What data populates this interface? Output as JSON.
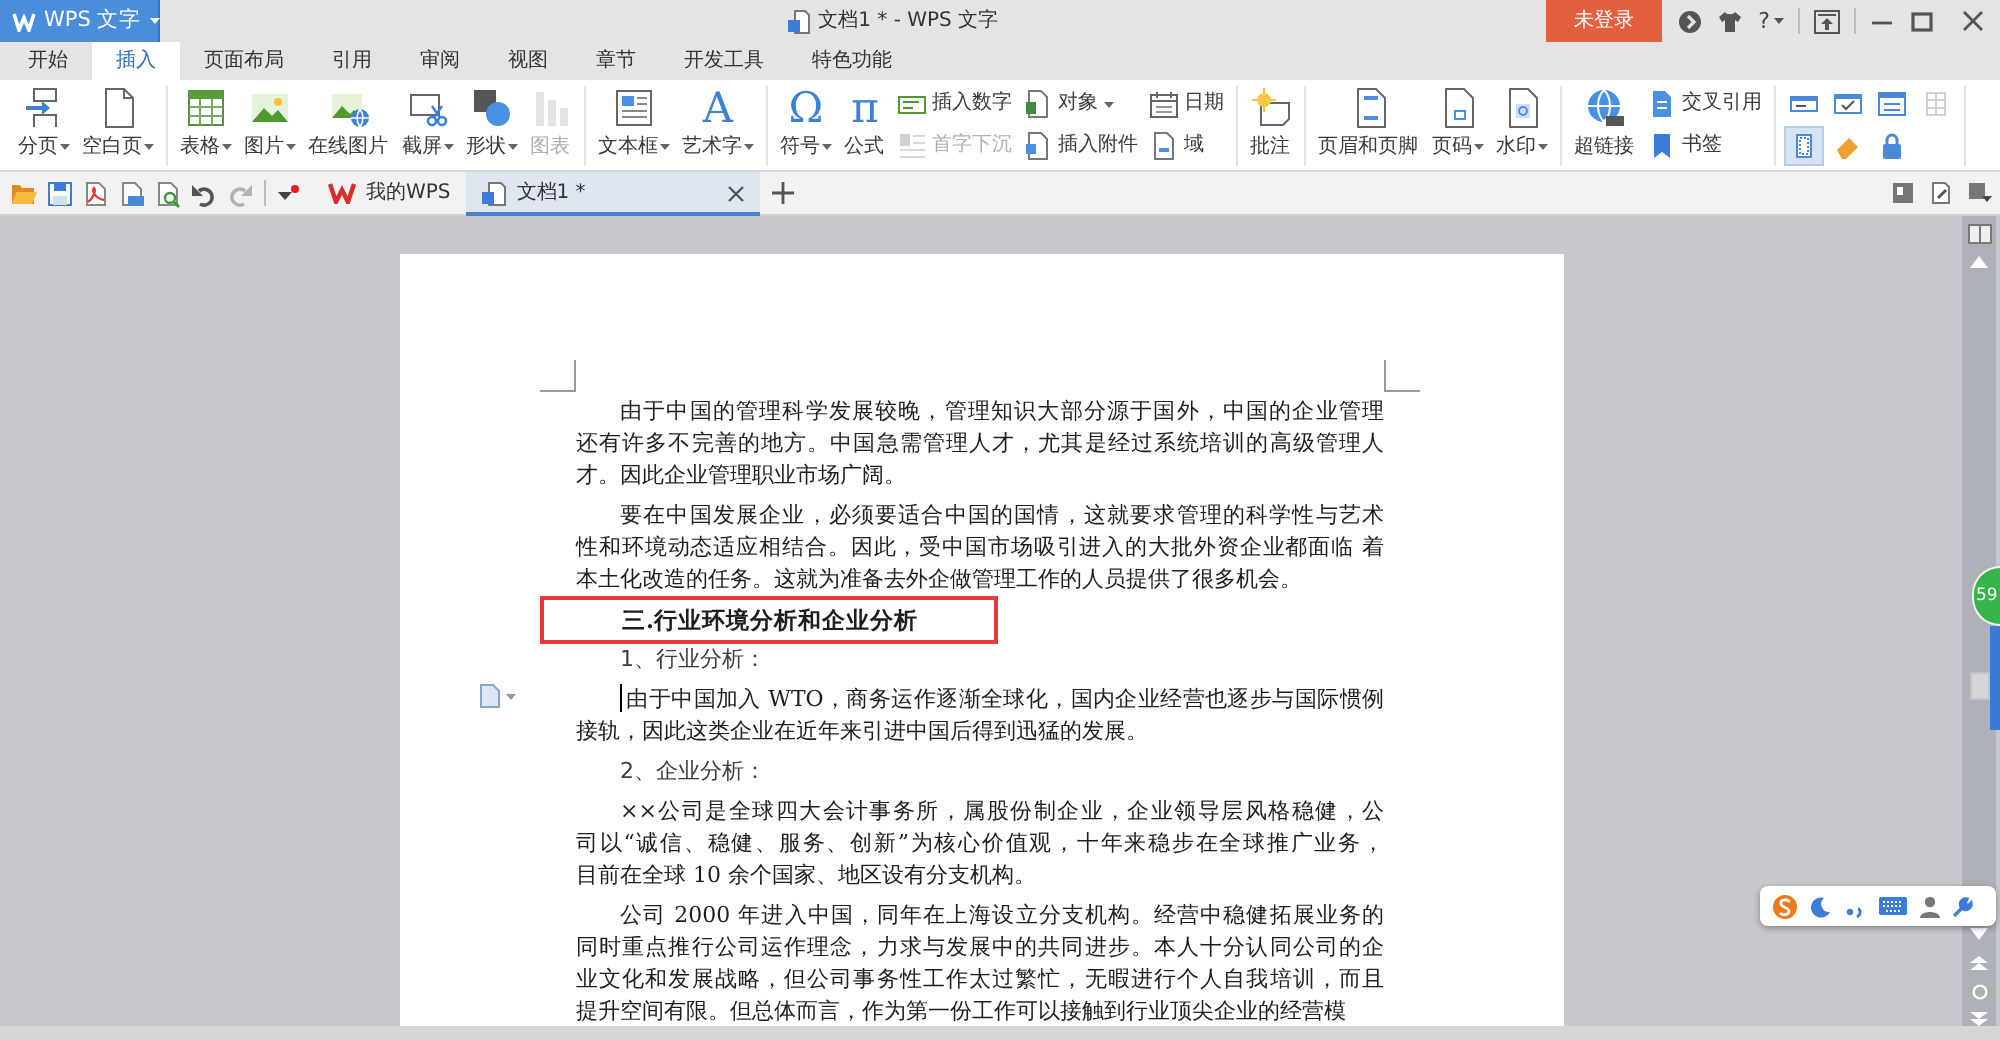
{
  "app_menu": {
    "label": "WPS 文字"
  },
  "window": {
    "title": "文档1 * - WPS 文字"
  },
  "account": {
    "label": "未登录"
  },
  "help": {
    "label": "?"
  },
  "ribbon_tabs": [
    {
      "label": "开始",
      "selected": false
    },
    {
      "label": "插入",
      "selected": true
    },
    {
      "label": "页面布局",
      "selected": false
    },
    {
      "label": "引用",
      "selected": false
    },
    {
      "label": "审阅",
      "selected": false
    },
    {
      "label": "视图",
      "selected": false
    },
    {
      "label": "章节",
      "selected": false
    },
    {
      "label": "开发工具",
      "selected": false
    },
    {
      "label": "特色功能",
      "selected": false
    }
  ],
  "ribbon_groups": [
    {
      "items": [
        {
          "kind": "large",
          "label": "分页",
          "dropdown": true,
          "disabled": false
        },
        {
          "kind": "large",
          "label": "空白页",
          "dropdown": true,
          "disabled": false
        }
      ]
    },
    {
      "items": [
        {
          "kind": "large",
          "label": "表格",
          "dropdown": true,
          "disabled": false
        },
        {
          "kind": "large",
          "label": "图片",
          "dropdown": true,
          "disabled": false
        },
        {
          "kind": "large",
          "label": "在线图片",
          "dropdown": false,
          "disabled": false
        },
        {
          "kind": "large",
          "label": "截屏",
          "dropdown": true,
          "disabled": false
        },
        {
          "kind": "large",
          "label": "形状",
          "dropdown": true,
          "disabled": false
        },
        {
          "kind": "large",
          "label": "图表",
          "dropdown": false,
          "disabled": true
        }
      ]
    },
    {
      "items": [
        {
          "kind": "large",
          "label": "文本框",
          "dropdown": true,
          "disabled": false
        },
        {
          "kind": "large",
          "label": "艺术字",
          "glyph": "A",
          "dropdown": true,
          "disabled": false
        }
      ]
    },
    {
      "items": [
        {
          "kind": "large",
          "label": "符号",
          "glyph": "Ω",
          "dropdown": true,
          "disabled": false
        },
        {
          "kind": "large",
          "label": "公式",
          "glyph": "π",
          "dropdown": false,
          "disabled": false
        },
        {
          "kind": "small",
          "label": "插入数字",
          "dropdown": false,
          "disabled": false
        },
        {
          "kind": "small",
          "label": "首字下沉",
          "dropdown": false,
          "disabled": true
        },
        {
          "kind": "small",
          "label": "对象",
          "dropdown": true,
          "disabled": false
        },
        {
          "kind": "small",
          "label": "插入附件",
          "dropdown": false,
          "disabled": false
        },
        {
          "kind": "small",
          "label": "日期",
          "dropdown": false,
          "disabled": false
        },
        {
          "kind": "small",
          "label": "域",
          "dropdown": false,
          "disabled": false
        }
      ]
    },
    {
      "items": [
        {
          "kind": "large",
          "label": "批注",
          "dropdown": false,
          "disabled": false
        }
      ]
    },
    {
      "items": [
        {
          "kind": "large",
          "label": "页眉和页脚",
          "dropdown": false,
          "disabled": false
        },
        {
          "kind": "large",
          "label": "页码",
          "dropdown": true,
          "disabled": false
        },
        {
          "kind": "large",
          "label": "水印",
          "dropdown": true,
          "disabled": false
        }
      ]
    },
    {
      "items": [
        {
          "kind": "large",
          "label": "超链接",
          "dropdown": false,
          "disabled": false
        },
        {
          "kind": "small",
          "label": "交叉引用",
          "dropdown": false,
          "disabled": false
        },
        {
          "kind": "small",
          "label": "书签",
          "dropdown": false,
          "disabled": false
        }
      ]
    },
    {
      "items": [
        {
          "kind": "tool",
          "selected": false,
          "disabled": false
        },
        {
          "kind": "tool",
          "selected": false,
          "disabled": false
        },
        {
          "kind": "tool",
          "selected": false,
          "disabled": false
        },
        {
          "kind": "tool",
          "selected": false,
          "disabled": true
        },
        {
          "kind": "tool",
          "selected": true,
          "disabled": false
        },
        {
          "kind": "tool",
          "selected": false,
          "disabled": false
        },
        {
          "kind": "tool",
          "selected": false,
          "disabled": false
        }
      ]
    }
  ],
  "quick_access": [
    {
      "disabled": false
    },
    {
      "disabled": false
    },
    {
      "disabled": false
    },
    {
      "disabled": false
    },
    {
      "disabled": false
    },
    {
      "disabled": false
    },
    {
      "disabled": true
    }
  ],
  "doc_tabs": [
    {
      "label": "我的WPS",
      "selected": false,
      "closable": false
    },
    {
      "label": "文档1 *",
      "selected": true,
      "closable": true
    }
  ],
  "document": {
    "paragraphs": [
      {
        "kind": "body",
        "highlighted": false,
        "cursor": false,
        "lines": [
          "由于中国的管理科学发展较晚，管理知识大部分源于国外，中国的企业管理",
          "还有许多不完善的地方。中国急需管理人才，尤其是经过系统培训的高级管理人",
          "才。因此企业管理职业市场广阔。"
        ]
      },
      {
        "kind": "body",
        "highlighted": false,
        "cursor": false,
        "lines": [
          "要在中国发展企业，必须要适合中国的国情，这就要求管理的科学性与艺术",
          "性和环境动态适应相结合。因此，受中国市场吸引进入的大批外资企业都面临 着",
          "本土化改造的任务。这就为准备去外企做管理工作的人员提供了很多机会。"
        ]
      },
      {
        "kind": "heading",
        "highlighted": true,
        "cursor": false,
        "lines": [
          "三.行业环境分析和企业分析"
        ]
      },
      {
        "kind": "label",
        "highlighted": false,
        "cursor": false,
        "lines": [
          "1、行业分析："
        ]
      },
      {
        "kind": "body",
        "highlighted": false,
        "cursor": true,
        "lines": [
          "由于中国加入 WTO，商务运作逐渐全球化，国内企业经营也逐步与国际惯例",
          "接轨，因此这类企业在近年来引进中国后得到迅猛的发展。"
        ]
      },
      {
        "kind": "label",
        "highlighted": false,
        "cursor": false,
        "lines": [
          "2、企业分析："
        ]
      },
      {
        "kind": "body",
        "highlighted": false,
        "cursor": false,
        "lines": [
          "××公司是全球四大会计事务所，属股份制企业，企业领导层风格稳健，公",
          "司以“诚信、稳健、服务、创新”为核心价值观，十年来稳步在全球推广业务，",
          "目前在全球 10 余个国家、地区设有分支机构。"
        ]
      },
      {
        "kind": "body",
        "highlighted": false,
        "cursor": false,
        "lines": [
          "公司 2000 年进入中国，同年在上海设立分支机构。经营中稳健拓展业务的",
          "同时重点推行公司运作理念，力求与发展中的共同进步。本人十分认同公司的企",
          "业文化和发展战略，但公司事务性工作太过繁忙，无暇进行个人自我培训，而且",
          "提升空间有限。但总体而言，作为第一份工作可以接触到行业顶尖企业的经营模"
        ]
      }
    ]
  },
  "speed_ball": {
    "label": "59"
  }
}
